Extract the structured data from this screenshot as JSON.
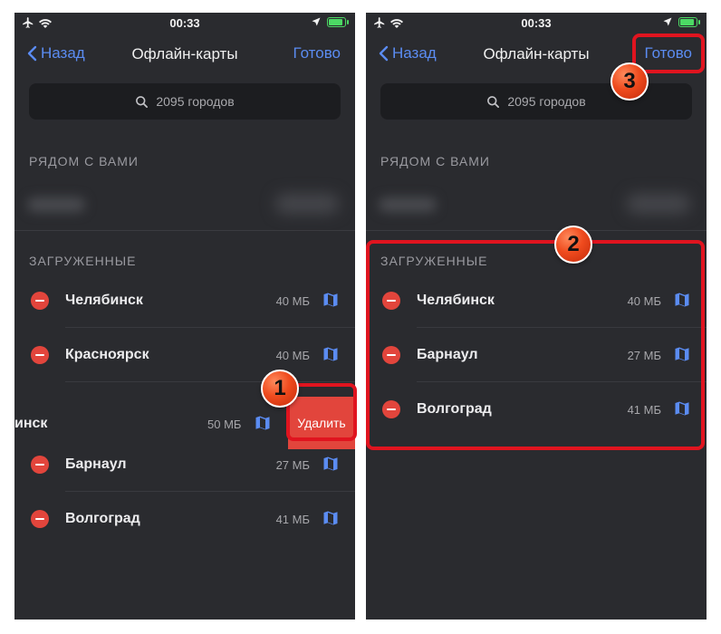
{
  "status_bar": {
    "time": "00:33"
  },
  "navbar": {
    "back_label": "Назад",
    "title": "Офлайн-карты",
    "done_label": "Готово"
  },
  "search": {
    "text": "2095 городов"
  },
  "sections": {
    "nearby": "РЯДОМ С ВАМИ",
    "downloaded": "ЗАГРУЖЕННЫЕ"
  },
  "left_list": [
    {
      "city": "Челябинск",
      "size": "40 МБ"
    },
    {
      "city": "Красноярск",
      "size": "40 МБ"
    },
    {
      "city": "Барнаул",
      "size": "27 МБ"
    },
    {
      "city": "Волгоград",
      "size": "41 МБ"
    }
  ],
  "swiped_row": {
    "city_partial": "инск",
    "size": "50 МБ",
    "delete_label": "Удалить"
  },
  "right_list": [
    {
      "city": "Челябинск",
      "size": "40 МБ"
    },
    {
      "city": "Барнаул",
      "size": "27 МБ"
    },
    {
      "city": "Волгоград",
      "size": "41 МБ"
    }
  ],
  "badges": {
    "one": "1",
    "two": "2",
    "three": "3"
  },
  "colors": {
    "background": "#2a2b2f",
    "accent": "#5b8cf2",
    "delete": "#e2453c",
    "highlight": "#e0141f",
    "battery": "#4cd964"
  },
  "icons": [
    "airplane-icon",
    "wifi-icon",
    "location-arrow-icon",
    "battery-icon",
    "chevron-left-icon",
    "search-icon",
    "minus-circle-icon",
    "map-icon"
  ]
}
